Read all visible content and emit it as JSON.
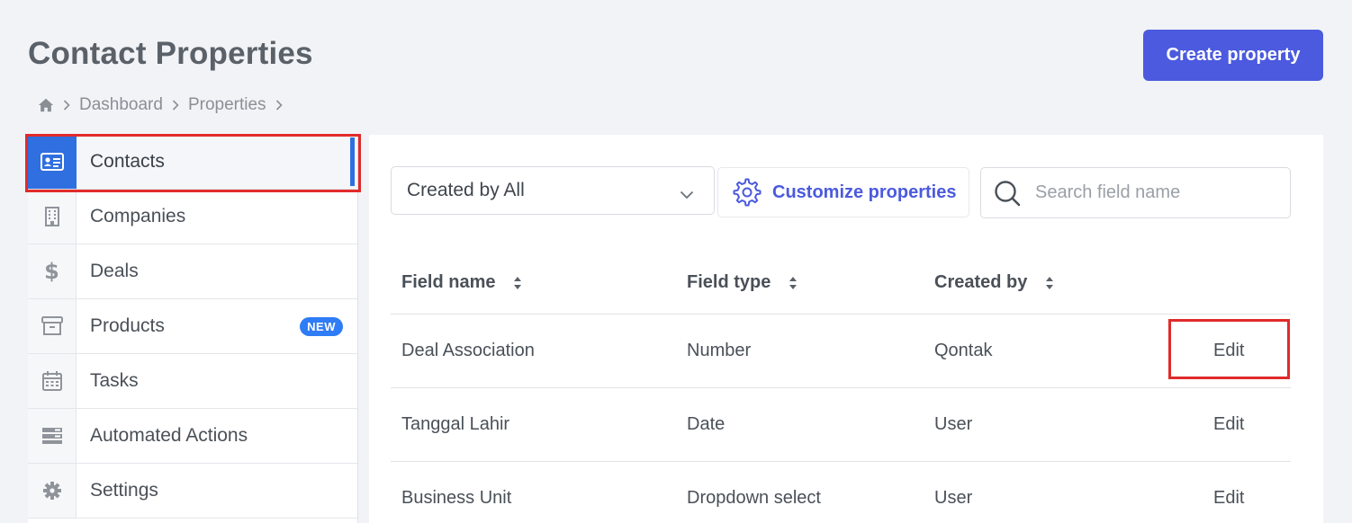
{
  "header": {
    "title": "Contact Properties",
    "create_button": "Create property"
  },
  "breadcrumb": {
    "items": [
      "Dashboard",
      "Properties"
    ]
  },
  "sidebar": {
    "items": [
      {
        "label": "Contacts",
        "icon": "contact-card-icon",
        "active": true
      },
      {
        "label": "Companies",
        "icon": "building-icon"
      },
      {
        "label": "Deals",
        "icon": "dollar-icon"
      },
      {
        "label": "Products",
        "icon": "archive-box-icon",
        "badge": "NEW"
      },
      {
        "label": "Tasks",
        "icon": "calendar-icon"
      },
      {
        "label": "Automated Actions",
        "icon": "server-stack-icon"
      },
      {
        "label": "Settings",
        "icon": "gear-icon"
      }
    ]
  },
  "filters": {
    "created_by_value": "Created by All",
    "customize_label": "Customize properties",
    "search_placeholder": "Search field name"
  },
  "table": {
    "columns": [
      "Field name",
      "Field type",
      "Created by"
    ],
    "rows": [
      {
        "field_name": "Deal Association",
        "field_type": "Number",
        "created_by": "Qontak",
        "action": "Edit"
      },
      {
        "field_name": "Tanggal Lahir",
        "field_type": "Date",
        "created_by": "User",
        "action": "Edit"
      },
      {
        "field_name": "Business Unit",
        "field_type": "Dropdown select",
        "created_by": "User",
        "action": "Edit"
      }
    ]
  },
  "colors": {
    "primary": "#4b5ade",
    "active_blue": "#2f6fe0",
    "highlight_red": "#e02b2b",
    "badge_blue": "#2e7cf6"
  }
}
